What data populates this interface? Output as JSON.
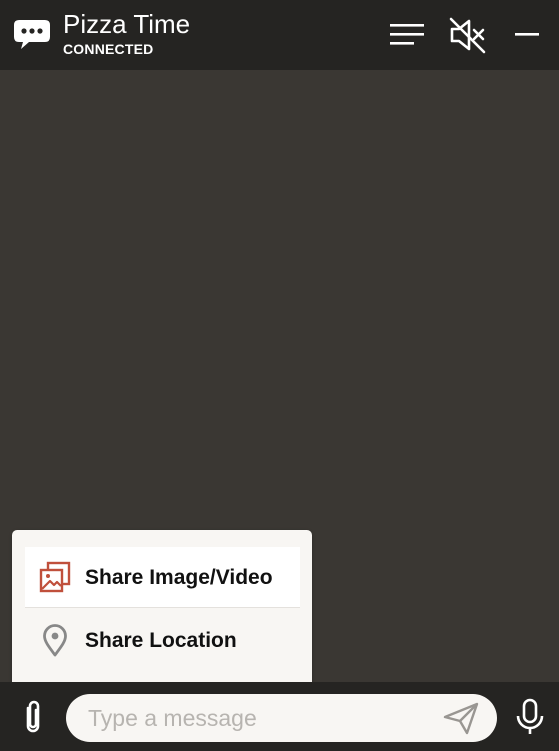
{
  "header": {
    "title": "Pizza Time",
    "status": "CONNECTED",
    "icons": {
      "chat": "chat-bubble-icon",
      "menu": "menu-lines-icon",
      "mute": "speaker-muted-icon",
      "minimize": "minimize-icon"
    }
  },
  "attachment_menu": {
    "items": [
      {
        "label": "Share Image/Video",
        "icon": "image-gallery-icon"
      },
      {
        "label": "Share Location",
        "icon": "location-pin-icon"
      }
    ]
  },
  "composer": {
    "placeholder": "Type a message",
    "value": "",
    "icons": {
      "attach": "paperclip-icon",
      "send": "send-icon",
      "mic": "microphone-icon"
    }
  },
  "colors": {
    "header_bg": "#252422",
    "chat_bg": "#3a3733",
    "popup_bg": "#f8f6f3",
    "image_icon_accent": "#c0503c",
    "icon_gray": "#888888"
  }
}
